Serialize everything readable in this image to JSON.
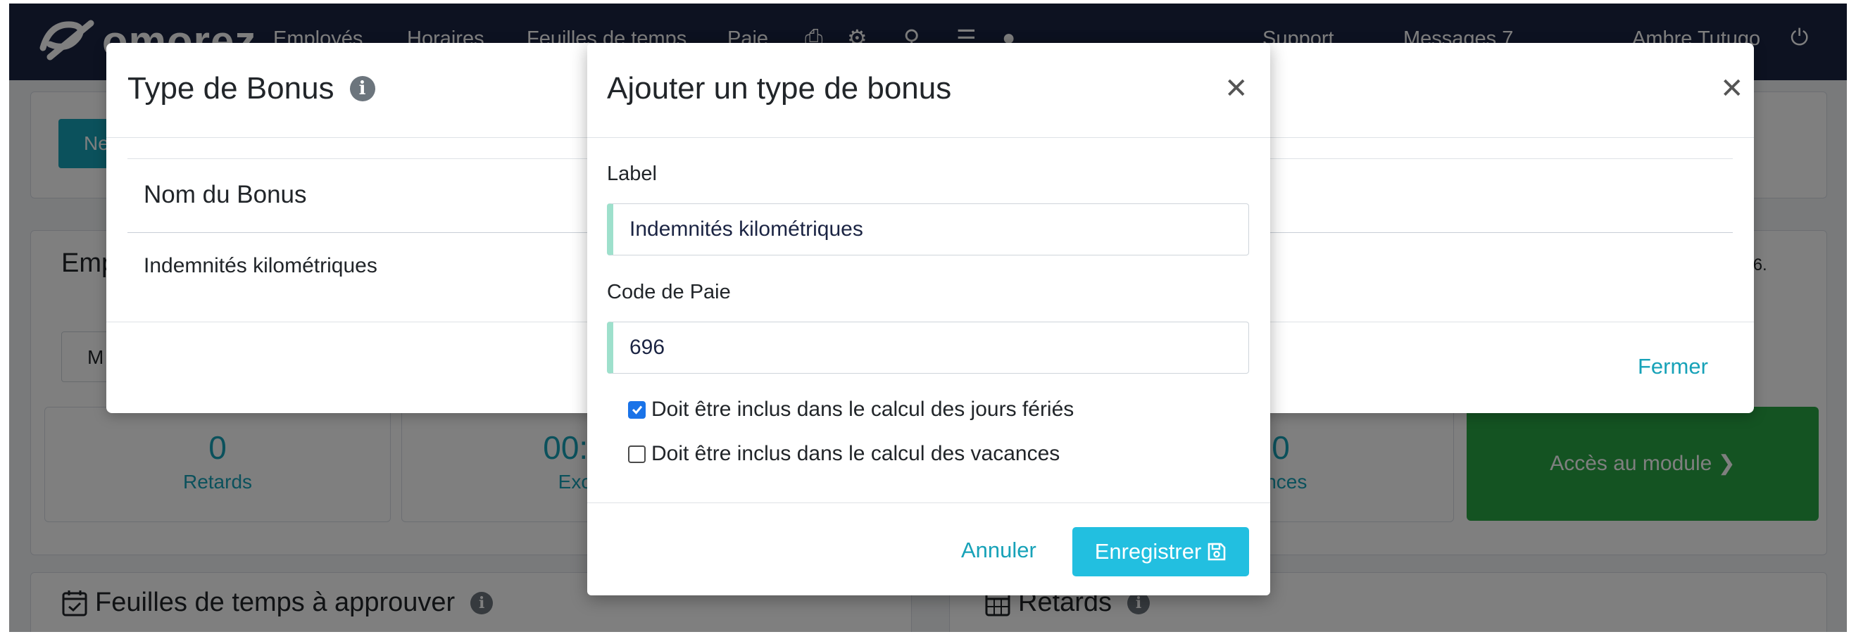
{
  "navbar": {
    "logo": "omorez",
    "items": [
      "Employés",
      "Horaires",
      "Feuilles de temps",
      "Paie"
    ],
    "support": "Support",
    "messages": "Messages 7",
    "user": "Ambre Tutugo"
  },
  "background": {
    "new_button": "Ne",
    "employees_title": "Emp",
    "employee_select": "M",
    "year_suffix": "026.",
    "stats": [
      {
        "value": "0",
        "label": "Retards"
      },
      {
        "value": "00:0",
        "label": "Exc"
      },
      {
        "value": "0",
        "label": "ences"
      }
    ],
    "access_button": "Accès au module ❯",
    "timesheets_title": "Feuilles de temps à approuver",
    "lates_title": "Retards"
  },
  "bonus_modal": {
    "title": "Type de Bonus",
    "column_header": "Nom du Bonus",
    "rows": [
      "Indemnités kilométriques"
    ],
    "close_label": "Fermer"
  },
  "add_modal": {
    "title": "Ajouter un type de bonus",
    "label_field": {
      "label": "Label",
      "value": "Indemnités kilométriques"
    },
    "code_field": {
      "label": "Code de Paie",
      "value": "696"
    },
    "checkboxes": [
      {
        "label": "Doit être inclus dans le calcul des jours fériés",
        "checked": true
      },
      {
        "label": "Doit être inclus dans le calcul des vacances",
        "checked": false
      }
    ],
    "cancel_label": "Annuler",
    "save_label": "Enregistrer"
  },
  "colors": {
    "navbar": "#1b2443",
    "accent": "#17a2b8",
    "save_button": "#22bfe0",
    "input_bar": "#9ee0cc",
    "checkbox": "#1a73e8"
  }
}
